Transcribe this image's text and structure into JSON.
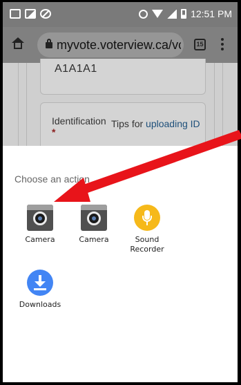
{
  "status_bar": {
    "time": "12:51 PM",
    "icons": [
      "mail-icon",
      "image-icon",
      "block-icon",
      "alarm-icon",
      "wifi-icon",
      "signal-icon",
      "battery-icon"
    ]
  },
  "browser": {
    "url": "myvote.voterview.ca/vc",
    "tab_count": "15",
    "icons": [
      "home-icon",
      "lock-icon",
      "more-vert-icon"
    ]
  },
  "page": {
    "postal_code": "A1A1A1",
    "id_label": "Identification",
    "required_mark": "*",
    "tips_prefix": "Tips for",
    "tips_link": "uploading ID"
  },
  "sheet": {
    "title": "Choose an action",
    "actions": [
      {
        "label": "Camera",
        "icon": "camera-icon"
      },
      {
        "label": "Camera",
        "icon": "camera-icon"
      },
      {
        "label": "Sound Recorder",
        "icon": "microphone-icon"
      },
      {
        "label": "Downloads",
        "icon": "download-icon"
      }
    ]
  },
  "colors": {
    "annotation_arrow": "#e8141a",
    "sound_recorder": "#f6b91a",
    "downloads": "#4285f4",
    "link": "#1d4f7a"
  }
}
